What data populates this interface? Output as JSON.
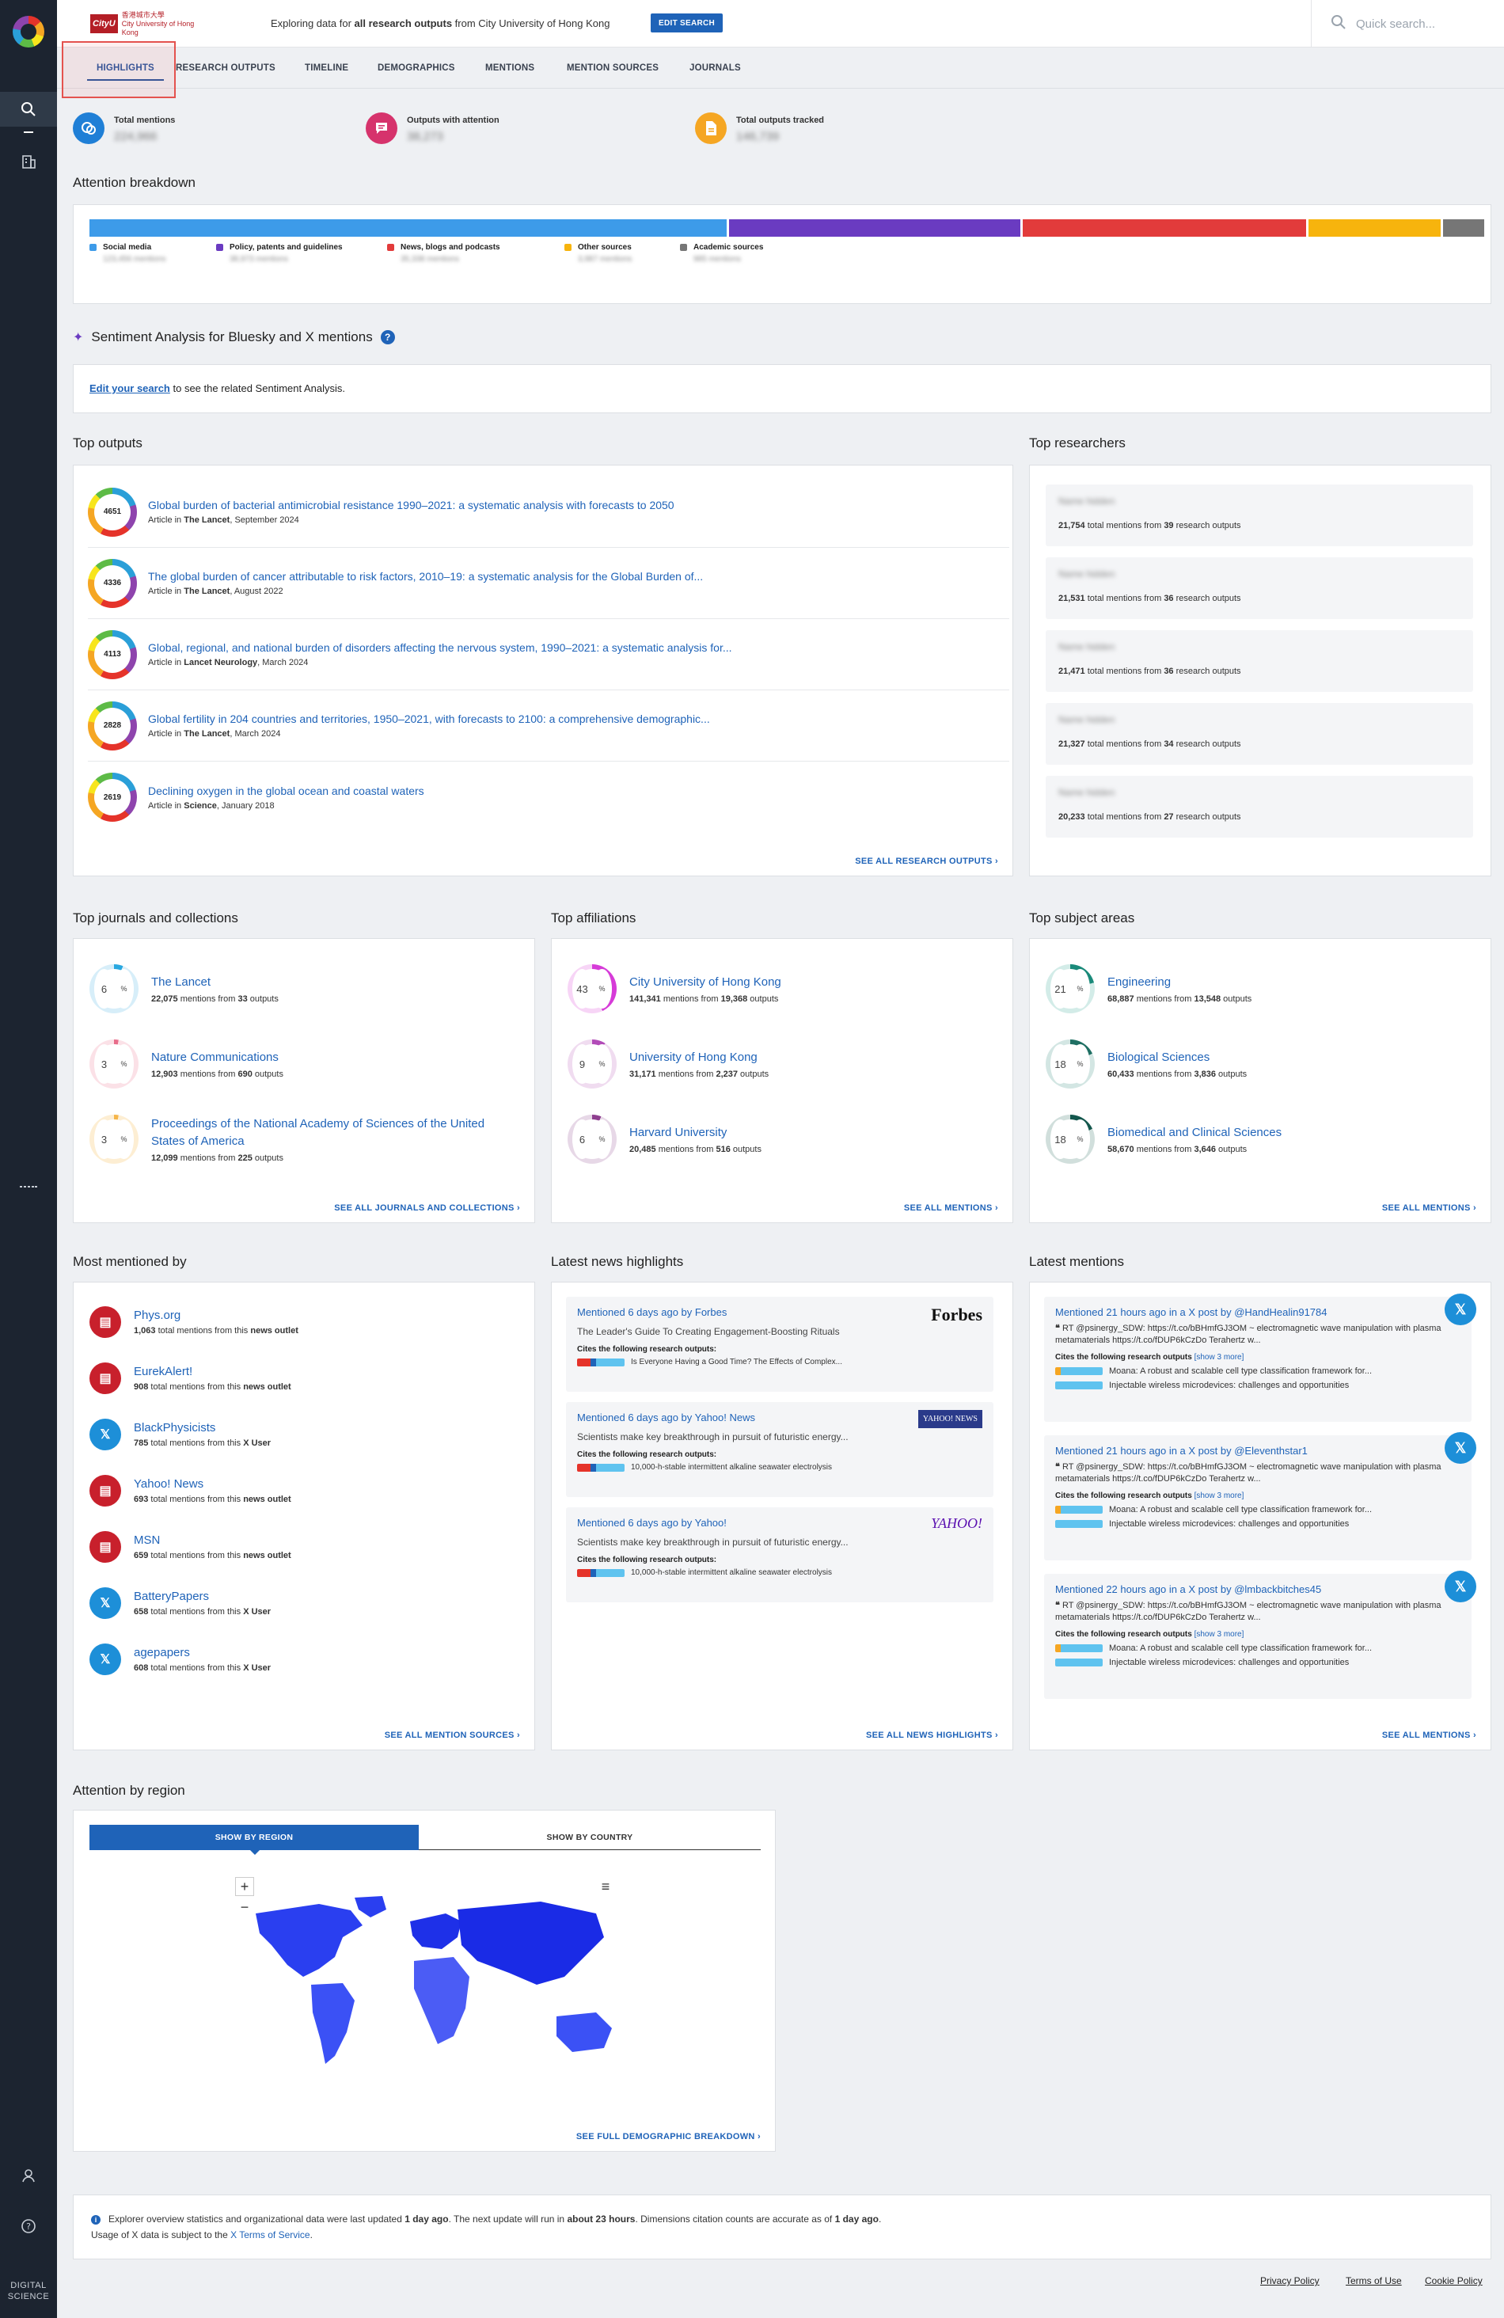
{
  "org": {
    "badge": "CityU",
    "name_line1": "香港城市大學",
    "name_line2": "City University of Hong Kong"
  },
  "topbar": {
    "explore_prefix": "Exploring data for ",
    "explore_bold": "all research outputs",
    "explore_suffix": " from City University of Hong Kong",
    "edit_label": "EDIT SEARCH",
    "search_placeholder": "Quick search..."
  },
  "tabs": [
    "HIGHLIGHTS",
    "RESEARCH OUTPUTS",
    "TIMELINE",
    "DEMOGRAPHICS",
    "MENTIONS",
    "MENTION SOURCES",
    "JOURNALS"
  ],
  "stats": [
    {
      "label": "Total mentions",
      "value": "224,966",
      "color": "#1f7fd6",
      "icon": "chat-icon"
    },
    {
      "label": "Outputs with attention",
      "value": "38,273",
      "color": "#d6336c",
      "icon": "message-icon"
    },
    {
      "label": "Total outputs tracked",
      "value": "146,739",
      "color": "#f5a623",
      "icon": "document-icon"
    }
  ],
  "attention": {
    "title": "Attention breakdown",
    "segments": [
      {
        "label": "Social media",
        "sub": "123,456 mentions",
        "color": "#3d9be9",
        "share": 0.46
      },
      {
        "label": "Policy, patents and guidelines",
        "sub": "38,973 mentions",
        "color": "#6a3bc1",
        "share": 0.21
      },
      {
        "label": "News, blogs and podcasts",
        "sub": "35,338 mentions",
        "color": "#e23b3b",
        "share": 0.205
      },
      {
        "label": "Other sources",
        "sub": "3,987 mentions",
        "color": "#f7b40d",
        "share": 0.095
      },
      {
        "label": "Academic sources",
        "sub": "985 mentions",
        "color": "#767676",
        "share": 0.03
      }
    ]
  },
  "sentiment": {
    "title": "Sentiment Analysis for Bluesky and X mentions",
    "link": "Edit your search",
    "rest": " to see the related Sentiment Analysis."
  },
  "top_outputs": {
    "title": "Top outputs",
    "items": [
      {
        "score": "4651",
        "title": "Global burden of bacterial antimicrobial resistance 1990–2021: a systematic analysis with forecasts to 2050",
        "type": "Article in ",
        "journal": "The Lancet",
        "date": ", September 2024"
      },
      {
        "score": "4336",
        "title": "The global burden of cancer attributable to risk factors, 2010–19: a systematic analysis for the Global Burden of...",
        "type": "Article in ",
        "journal": "The Lancet",
        "date": ", August 2022"
      },
      {
        "score": "4113",
        "title": "Global, regional, and national burden of disorders affecting the nervous system, 1990–2021: a systematic analysis for...",
        "type": "Article in ",
        "journal": "Lancet Neurology",
        "date": ", March 2024"
      },
      {
        "score": "2828",
        "title": "Global fertility in 204 countries and territories, 1950–2021, with forecasts to 2100: a comprehensive demographic...",
        "type": "Article in ",
        "journal": "The Lancet",
        "date": ", March 2024"
      },
      {
        "score": "2619",
        "title": "Declining oxygen in the global ocean and coastal waters",
        "type": "Article in ",
        "journal": "Science",
        "date": ", January 2018"
      }
    ],
    "see_all": "SEE ALL RESEARCH OUTPUTS"
  },
  "top_researchers": {
    "title": "Top researchers",
    "items": [
      {
        "name": "Name hidden",
        "mentions": "21,754",
        "outputs": "39"
      },
      {
        "name": "Name hidden",
        "mentions": "21,531",
        "outputs": "36"
      },
      {
        "name": "Name hidden",
        "mentions": "21,471",
        "outputs": "36"
      },
      {
        "name": "Name hidden",
        "mentions": "21,327",
        "outputs": "34"
      },
      {
        "name": "Name hidden",
        "mentions": "20,233",
        "outputs": "27"
      }
    ],
    "mid": " total mentions from ",
    "tail": " research outputs"
  },
  "journals": {
    "title": "Top journals and collections",
    "items": [
      {
        "pct": "6",
        "name": "The Lancet",
        "mentions": "22,075",
        "outputs": "33",
        "color": "#29a8e0",
        "track": "#d7eef9"
      },
      {
        "pct": "3",
        "name": "Nature Communications",
        "mentions": "12,903",
        "outputs": "690",
        "color": "#e86c8a",
        "track": "#fbe1e7"
      },
      {
        "pct": "3",
        "name": "Proceedings of the National Academy of Sciences of the United States of America",
        "mentions": "12,099",
        "outputs": "225",
        "color": "#f5b54a",
        "track": "#fdeed3"
      }
    ],
    "see_all": "SEE ALL JOURNALS AND COLLECTIONS"
  },
  "affiliations": {
    "title": "Top affiliations",
    "items": [
      {
        "pct": "43",
        "name": "City University of Hong Kong",
        "mentions": "141,341",
        "outputs": "19,368",
        "color": "#d63bd8",
        "track": "#f7d5f6"
      },
      {
        "pct": "9",
        "name": "University of Hong Kong",
        "mentions": "31,171",
        "outputs": "2,237",
        "color": "#b24bb8",
        "track": "#f0dcf0"
      },
      {
        "pct": "6",
        "name": "Harvard University",
        "mentions": "20,485",
        "outputs": "516",
        "color": "#8e3f8f",
        "track": "#e7d8e7"
      }
    ],
    "see_all": "SEE ALL MENTIONS"
  },
  "subjects": {
    "title": "Top subject areas",
    "items": [
      {
        "pct": "21",
        "name": "Engineering",
        "mentions": "68,887",
        "outputs": "13,548",
        "color": "#1a8a7a",
        "track": "#d3ece8"
      },
      {
        "pct": "18",
        "name": "Biological Sciences",
        "mentions": "60,433",
        "outputs": "3,836",
        "color": "#1f6f63",
        "track": "#d3e6e3"
      },
      {
        "pct": "18",
        "name": "Biomedical and Clinical Sciences",
        "mentions": "58,670",
        "outputs": "3,646",
        "color": "#14574d",
        "track": "#d1dfdc"
      }
    ],
    "see_all": "SEE ALL MENTIONS"
  },
  "mentions_from": " mentions from ",
  "outputs_word": " outputs",
  "most_mentioned": {
    "title": "Most mentioned by",
    "items": [
      {
        "name": "Phys.org",
        "count": "1,063",
        "kind": "news outlet",
        "icon": "news-icon",
        "glyph": "▤",
        "color": "#c8202c"
      },
      {
        "name": "EurekAlert!",
        "count": "908",
        "kind": "news outlet",
        "icon": "news-icon",
        "glyph": "▤",
        "color": "#c8202c"
      },
      {
        "name": "BlackPhysicists",
        "count": "785",
        "kind": "X User",
        "icon": "x-icon",
        "glyph": "𝕏",
        "color": "#1d8fd8"
      },
      {
        "name": "Yahoo! News",
        "count": "693",
        "kind": "news outlet",
        "icon": "news-icon",
        "glyph": "▤",
        "color": "#c8202c"
      },
      {
        "name": "MSN",
        "count": "659",
        "kind": "news outlet",
        "icon": "news-icon",
        "glyph": "▤",
        "color": "#c8202c"
      },
      {
        "name": "BatteryPapers",
        "count": "658",
        "kind": "X User",
        "icon": "x-icon",
        "glyph": "𝕏",
        "color": "#1d8fd8"
      },
      {
        "name": "agepapers",
        "count": "608",
        "kind": "X User",
        "icon": "x-icon",
        "glyph": "𝕏",
        "color": "#1d8fd8"
      }
    ],
    "mid": " total mentions from this ",
    "see_all": "SEE ALL MENTION SOURCES"
  },
  "news": {
    "title": "Latest news highlights",
    "cites_label": "Cites the following research outputs:",
    "items": [
      {
        "when": "Mentioned 6 days ago by Forbes",
        "headline": "The Leader's Guide To Creating Engagement-Boosting Rituals",
        "ref": "Is Everyone Having a Good Time? The Effects of Complex...",
        "logo": "Forbes"
      },
      {
        "when": "Mentioned 6 days ago by Yahoo! News",
        "headline": "Scientists make key breakthrough in pursuit of futuristic energy...",
        "ref": "10,000-h-stable intermittent alkaline seawater electrolysis",
        "logo": "YAHOO! NEWS"
      },
      {
        "when": "Mentioned 6 days ago by Yahoo!",
        "headline": "Scientists make key breakthrough in pursuit of futuristic energy...",
        "ref": "10,000-h-stable intermittent alkaline seawater electrolysis",
        "logo": "YAHOO!"
      }
    ],
    "see_all": "SEE ALL NEWS HIGHLIGHTS"
  },
  "latest": {
    "title": "Latest mentions",
    "cites_label": "Cites the following research outputs ",
    "show_more": "[show 3 more]",
    "ref1": "Moana: A robust and scalable cell type classification framework for...",
    "ref2": "Injectable wireless microdevices: challenges and opportunities",
    "items": [
      {
        "when": "Mentioned 21 hours ago in a X post by @HandHealin91784",
        "text": "RT @psinergy_SDW: https://t.co/bBHmfGJ3OM ~ electromagnetic wave manipulation with plasma metamaterials https://t.co/fDUP6kCzDo Terahertz w..."
      },
      {
        "when": "Mentioned 21 hours ago in a X post by @Eleventhstar1",
        "text": "RT @psinergy_SDW: https://t.co/bBHmfGJ3OM ~ electromagnetic wave manipulation with plasma metamaterials https://t.co/fDUP6kCzDo Terahertz w..."
      },
      {
        "when": "Mentioned 22 hours ago in a X post by @lmbackbitches45",
        "text": "RT @psinergy_SDW: https://t.co/bBHmfGJ3OM ~ electromagnetic wave manipulation with plasma metamaterials https://t.co/fDUP6kCzDo Terahertz w..."
      }
    ],
    "see_all": "SEE ALL MENTIONS"
  },
  "region": {
    "title": "Attention by region",
    "tab1": "SHOW BY REGION",
    "tab2": "SHOW BY COUNTRY",
    "see_all": "SEE FULL DEMOGRAPHIC BREAKDOWN"
  },
  "footer": {
    "line1_a": "Explorer overview statistics and organizational data were last updated ",
    "line1_b": "1 day ago",
    "line1_c": ". The next update will run in ",
    "line1_d": "about 23 hours",
    "line1_e": ". Dimensions citation counts are accurate as of ",
    "line1_f": "1 day ago",
    "line1_g": ".",
    "line2_a": "Usage of X data is subject to the ",
    "line2_link": "X Terms of Service",
    "line2_b": "."
  },
  "legal": [
    "Privacy Policy",
    "Terms of Use",
    "Cookie Policy"
  ],
  "brand": {
    "digital": "DIGITAL",
    "science": "SCIENCE"
  }
}
